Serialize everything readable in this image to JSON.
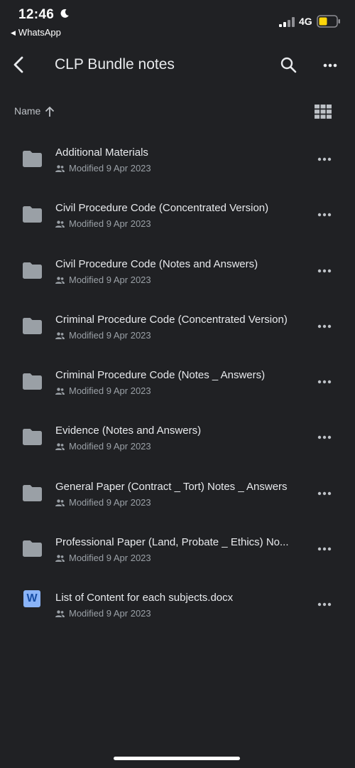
{
  "status_bar": {
    "time": "12:46",
    "back_app": "WhatsApp",
    "network": "4G",
    "battery_color": "#ffd60a"
  },
  "app_bar": {
    "title": "CLP Bundle notes",
    "back_icon": "chevron-left-icon",
    "search_icon": "search-icon",
    "more_icon": "more-horizontal-icon"
  },
  "sort": {
    "label": "Name",
    "direction_icon": "arrow-up-icon",
    "view_icon": "grid-view-icon"
  },
  "files": [
    {
      "name": "Additional Materials",
      "meta": "Modified 9 Apr 2023",
      "type": "folder"
    },
    {
      "name": "Civil Procedure Code (Concentrated Version)",
      "meta": "Modified 9 Apr 2023",
      "type": "folder"
    },
    {
      "name": "Civil Procedure Code (Notes and Answers)",
      "meta": "Modified 9 Apr 2023",
      "type": "folder"
    },
    {
      "name": "Criminal Procedure Code (Concentrated Version)",
      "meta": "Modified 9 Apr 2023",
      "type": "folder"
    },
    {
      "name": "Criminal Procedure Code (Notes _ Answers)",
      "meta": "Modified 9 Apr 2023",
      "type": "folder"
    },
    {
      "name": "Evidence (Notes and Answers)",
      "meta": "Modified 9 Apr 2023",
      "type": "folder"
    },
    {
      "name": "General Paper (Contract _ Tort) Notes _ Answers",
      "meta": "Modified 9 Apr 2023",
      "type": "folder"
    },
    {
      "name": "Professional Paper (Land, Probate _ Ethics) No...",
      "meta": "Modified 9 Apr 2023",
      "type": "folder"
    },
    {
      "name": "List of Content for each subjects.docx",
      "meta": "Modified 9 Apr 2023",
      "type": "docx",
      "icon_letter": "W"
    }
  ],
  "colors": {
    "background": "#202124",
    "folder": "#9aa0a6",
    "docx_icon": "#8ab4f8"
  }
}
